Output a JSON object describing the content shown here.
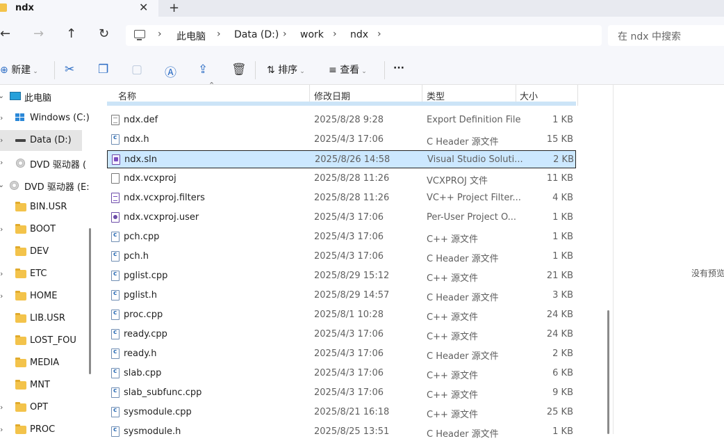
{
  "tab": {
    "title": "ndx",
    "close": "✕",
    "new": "+"
  },
  "nav": {
    "back": "←",
    "forward": "→",
    "up": "↑",
    "refresh": "↻",
    "breadcrumbs": [
      "此电脑",
      "Data (D:)",
      "work",
      "ndx"
    ],
    "chevron": "›",
    "search_placeholder": "在 ndx 中搜索"
  },
  "toolbar": {
    "new_label": "新建",
    "sort_label": "排序",
    "view_label": "查看",
    "more": "···"
  },
  "sidebar": {
    "items": [
      {
        "label": "此电脑",
        "icon": "pc-icon"
      },
      {
        "label": "Windows (C:)",
        "icon": "windows-drive-icon"
      },
      {
        "label": "Data (D:)",
        "icon": "drive-icon",
        "selected": true
      },
      {
        "label": "DVD 驱动器 (",
        "icon": "disc-icon"
      },
      {
        "label": "DVD 驱动器 (E:",
        "icon": "disc-icon"
      },
      {
        "label": "BIN.USR",
        "icon": "folder-icon"
      },
      {
        "label": "BOOT",
        "icon": "folder-icon"
      },
      {
        "label": "DEV",
        "icon": "folder-icon"
      },
      {
        "label": "ETC",
        "icon": "folder-icon"
      },
      {
        "label": "HOME",
        "icon": "folder-icon"
      },
      {
        "label": "LIB.USR",
        "icon": "folder-icon"
      },
      {
        "label": "LOST_FOU",
        "icon": "folder-icon"
      },
      {
        "label": "MEDIA",
        "icon": "folder-icon"
      },
      {
        "label": "MNT",
        "icon": "folder-icon"
      },
      {
        "label": "OPT",
        "icon": "folder-icon"
      },
      {
        "label": "PROC",
        "icon": "folder-icon"
      }
    ]
  },
  "columns": {
    "name": "名称",
    "date": "修改日期",
    "type": "类型",
    "size": "大小"
  },
  "files": [
    {
      "name": "ndx.def",
      "date": "2025/8/28 9:28",
      "type": "Export Definition File",
      "size": "1 KB",
      "icon": "def"
    },
    {
      "name": "ndx.h",
      "date": "2025/4/3 17:06",
      "type": "C Header 源文件",
      "size": "15 KB",
      "icon": "c"
    },
    {
      "name": "ndx.sln",
      "date": "2025/8/26 14:58",
      "type": "Visual Studio Soluti...",
      "size": "2 KB",
      "icon": "sln",
      "selected": true
    },
    {
      "name": "ndx.vcxproj",
      "date": "2025/8/28 11:26",
      "type": "VCXPROJ 文件",
      "size": "11 KB",
      "icon": "vcx"
    },
    {
      "name": "ndx.vcxproj.filters",
      "date": "2025/8/28 11:26",
      "type": "VC++ Project Filter...",
      "size": "4 KB",
      "icon": "filt"
    },
    {
      "name": "ndx.vcxproj.user",
      "date": "2025/4/3 17:06",
      "type": "Per-User Project O...",
      "size": "1 KB",
      "icon": "usr"
    },
    {
      "name": "pch.cpp",
      "date": "2025/4/3 17:06",
      "type": "C++ 源文件",
      "size": "1 KB",
      "icon": "c"
    },
    {
      "name": "pch.h",
      "date": "2025/4/3 17:06",
      "type": "C Header 源文件",
      "size": "1 KB",
      "icon": "c"
    },
    {
      "name": "pglist.cpp",
      "date": "2025/8/29 15:12",
      "type": "C++ 源文件",
      "size": "21 KB",
      "icon": "c"
    },
    {
      "name": "pglist.h",
      "date": "2025/8/29 14:57",
      "type": "C Header 源文件",
      "size": "3 KB",
      "icon": "c"
    },
    {
      "name": "proc.cpp",
      "date": "2025/8/1 10:28",
      "type": "C++ 源文件",
      "size": "24 KB",
      "icon": "c"
    },
    {
      "name": "ready.cpp",
      "date": "2025/4/3 17:06",
      "type": "C++ 源文件",
      "size": "24 KB",
      "icon": "c"
    },
    {
      "name": "ready.h",
      "date": "2025/4/3 17:06",
      "type": "C Header 源文件",
      "size": "2 KB",
      "icon": "c"
    },
    {
      "name": "slab.cpp",
      "date": "2025/4/3 17:06",
      "type": "C++ 源文件",
      "size": "6 KB",
      "icon": "c"
    },
    {
      "name": "slab_subfunc.cpp",
      "date": "2025/4/3 17:06",
      "type": "C++ 源文件",
      "size": "9 KB",
      "icon": "c"
    },
    {
      "name": "sysmodule.cpp",
      "date": "2025/8/21 16:18",
      "type": "C++ 源文件",
      "size": "25 KB",
      "icon": "c"
    },
    {
      "name": "sysmodule.h",
      "date": "2025/8/25 13:51",
      "type": "C Header 源文件",
      "size": "1 KB",
      "icon": "c"
    }
  ],
  "preview": {
    "text": "没有预览"
  }
}
